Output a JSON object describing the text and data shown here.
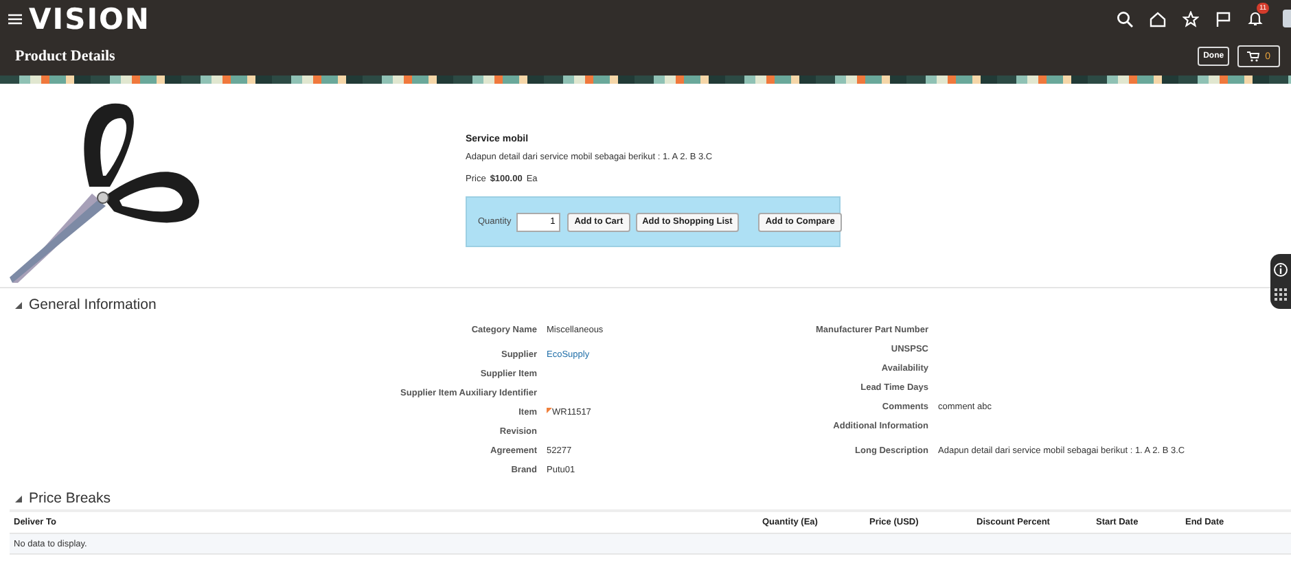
{
  "header": {
    "logo": "VISION",
    "notification_count": "11"
  },
  "page": {
    "title": "Product Details",
    "done_button": "Done",
    "cart_count": "0"
  },
  "product": {
    "name": "Service mobil",
    "description": "Adapun detail dari service mobil sebagai berikut : 1. A 2. B 3.C",
    "price_label": "Price",
    "price": "$100.00",
    "unit": "Ea",
    "quantity_label": "Quantity",
    "quantity": "1",
    "buttons": [
      "Add to Cart",
      "Add to Shopping List",
      "Add to Compare"
    ]
  },
  "general_information": {
    "title": "General Information",
    "expanded": true,
    "left_fields": [
      {
        "label": "Category Name",
        "value": "Miscellaneous",
        "kind": "text"
      },
      {
        "label": "Supplier",
        "value": "EcoSupply",
        "kind": "link"
      },
      {
        "label": "Supplier Item",
        "kind": "text"
      },
      {
        "label": "Supplier Item Auxiliary Identifier",
        "kind": "text"
      },
      {
        "label": "Item",
        "value": "WR11517",
        "kind": "flagged"
      },
      {
        "label": "Revision",
        "kind": "text"
      },
      {
        "label": "Agreement",
        "value": "52277",
        "kind": "text"
      },
      {
        "label": "Brand",
        "value": "Putu01",
        "kind": "text"
      }
    ],
    "right_fields": [
      {
        "label": "Manufacturer Part Number",
        "kind": "text"
      },
      {
        "label": "UNSPSC",
        "kind": "text"
      },
      {
        "label": "Availability",
        "kind": "text"
      },
      {
        "label": "Lead Time Days",
        "kind": "text"
      },
      {
        "label": "Comments",
        "value": "comment abc",
        "kind": "text"
      },
      {
        "label": "Additional Information",
        "kind": "text"
      },
      {
        "label": "Long Description",
        "value": "Adapun detail dari service mobil sebagai berikut : 1. A 2. B 3.C",
        "kind": "text"
      }
    ]
  },
  "price_breaks": {
    "title": "Price Breaks",
    "expanded": true,
    "columns": [
      "Deliver To",
      "Quantity (Ea)",
      "Price (USD)",
      "Discount Percent",
      "Start Date",
      "End Date"
    ],
    "empty_message": "No data to display."
  }
}
